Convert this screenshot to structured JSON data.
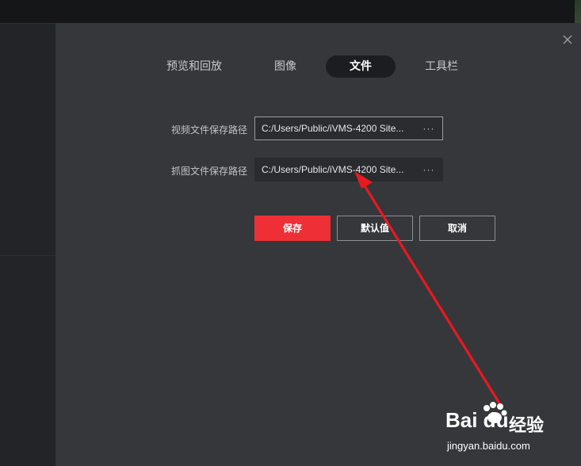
{
  "tabs": [
    {
      "label": "预览和回放",
      "active": false
    },
    {
      "label": "图像",
      "active": false
    },
    {
      "label": "文件",
      "active": true
    },
    {
      "label": "工具栏",
      "active": false
    }
  ],
  "settings": {
    "video_path_label": "视频文件保存路径",
    "video_path_value": "C:/Users/Public/iVMS-4200 Site...",
    "snapshot_path_label": "抓图文件保存路径",
    "snapshot_path_value": "C:/Users/Public/iVMS-4200 Site...",
    "browse_label": "···"
  },
  "buttons": {
    "save": "保存",
    "default": "默认值",
    "cancel": "取消"
  },
  "close_glyph": "×",
  "watermark": {
    "logo": "Bai du",
    "brand": "经验",
    "url": "jingyan.baidu.com"
  },
  "colors": {
    "panel_bg": "#35373b",
    "accent": "#ee2f36",
    "arrow": "#e8191f"
  }
}
